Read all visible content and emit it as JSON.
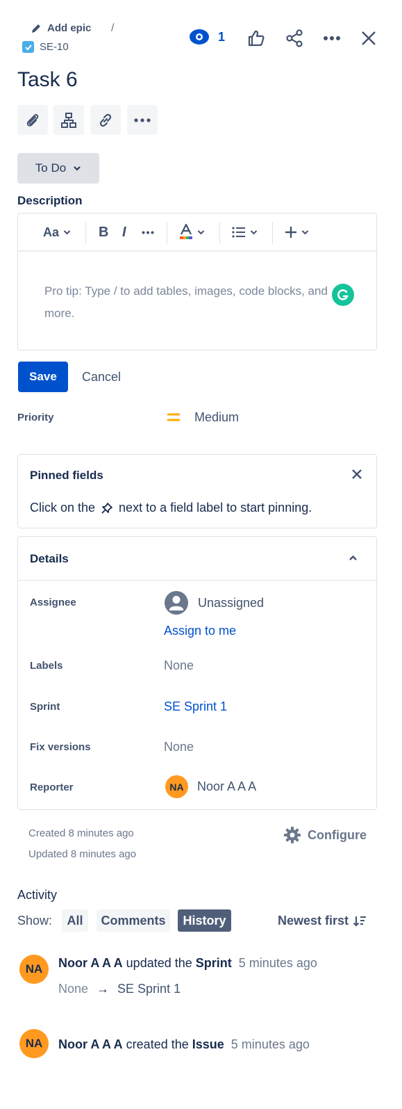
{
  "header": {
    "add_epic_label": "Add epic",
    "separator": "/",
    "issue_key": "SE-10",
    "watch_count": "1"
  },
  "issue": {
    "title": "Task 6",
    "status": "To Do"
  },
  "description": {
    "label": "Description",
    "toolbar": {
      "text_style": "Aa",
      "bold": "B",
      "italic": "I"
    },
    "placeholder": "Pro tip: Type / to add tables, images, code blocks, and more.",
    "save_label": "Save",
    "cancel_label": "Cancel"
  },
  "priority": {
    "label": "Priority",
    "value": "Medium",
    "color": "#ffab00"
  },
  "pinned": {
    "title": "Pinned fields",
    "hint_before": "Click on the",
    "hint_after": "next to a field label to start pinning."
  },
  "details": {
    "title": "Details",
    "assignee_label": "Assignee",
    "assignee_value": "Unassigned",
    "assign_to_me": "Assign to me",
    "labels_label": "Labels",
    "labels_value": "None",
    "sprint_label": "Sprint",
    "sprint_value": "SE Sprint 1",
    "fix_versions_label": "Fix versions",
    "fix_versions_value": "None",
    "reporter_label": "Reporter",
    "reporter_initials": "NA",
    "reporter_name": "Noor A A A"
  },
  "meta": {
    "created": "Created 8 minutes ago",
    "updated": "Updated 8 minutes ago",
    "configure_label": "Configure"
  },
  "activity": {
    "title": "Activity",
    "show_label": "Show:",
    "filters": [
      "All",
      "Comments",
      "History"
    ],
    "active_filter": "History",
    "sort_label": "Newest first",
    "entries": [
      {
        "initials": "NA",
        "user": "Noor A A A",
        "action": "updated the",
        "field": "Sprint",
        "time": "5 minutes ago",
        "from": "None",
        "arrow": "→",
        "to": "SE Sprint 1"
      },
      {
        "initials": "NA",
        "user": "Noor A A A",
        "action": "created the",
        "field": "Issue",
        "time": "5 minutes ago"
      }
    ]
  },
  "colors": {
    "primary": "#0052cc",
    "avatar": "#ff991f",
    "grammarly": "#15c39a",
    "checkbox": "#4bade8"
  }
}
